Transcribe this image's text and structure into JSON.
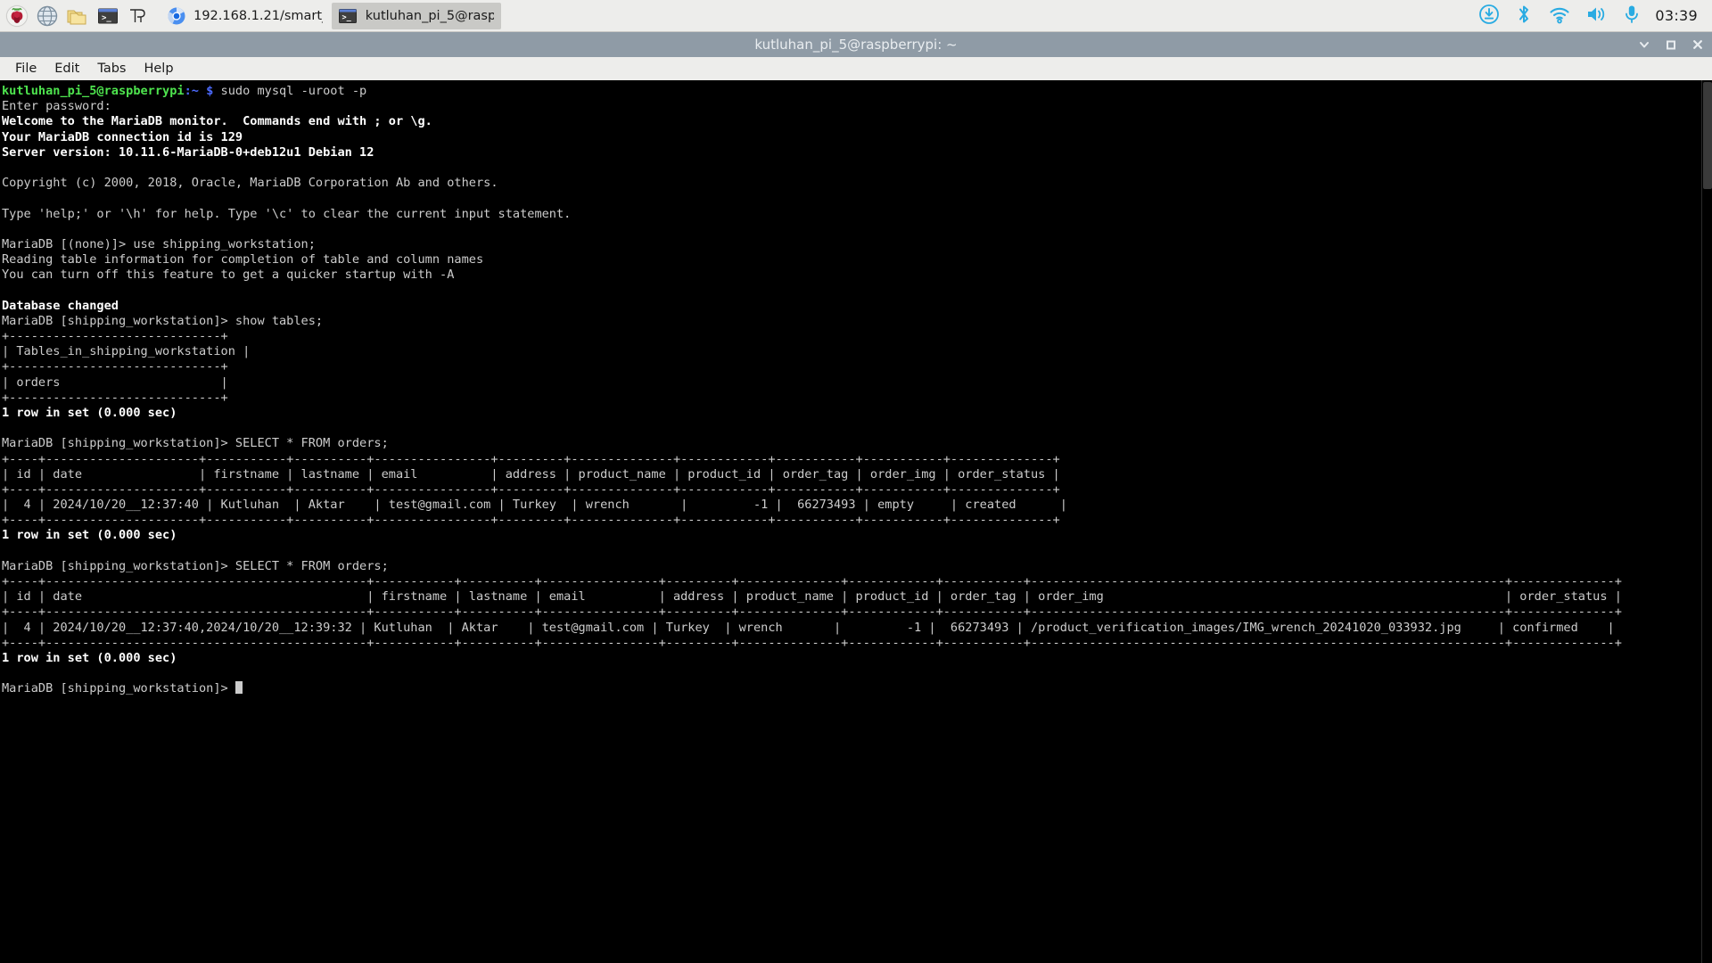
{
  "taskbar": {
    "launchers": [
      {
        "name": "raspberry-menu-icon",
        "label": "Raspberry Pi Menu"
      },
      {
        "name": "globe-browser-icon",
        "label": "Web Browser"
      },
      {
        "name": "file-manager-icon",
        "label": "File Manager"
      },
      {
        "name": "terminal-icon",
        "label": "Terminal"
      },
      {
        "name": "thonny-icon",
        "label": "Thonny"
      }
    ],
    "windows": [
      {
        "name": "taskbar-window-chromium",
        "icon": "chromium-icon",
        "label": "192.168.1.21/smart_..",
        "active": false
      },
      {
        "name": "taskbar-window-terminal",
        "icon": "terminal-icon",
        "label": "kutluhan_pi_5@rasp..",
        "active": true
      }
    ],
    "tray": [
      {
        "name": "software-update-icon"
      },
      {
        "name": "bluetooth-icon"
      },
      {
        "name": "wifi-icon"
      },
      {
        "name": "volume-icon"
      },
      {
        "name": "microphone-icon"
      }
    ],
    "clock": "03:39"
  },
  "window": {
    "title": "kutluhan_pi_5@raspberrypi: ~",
    "controls": [
      {
        "name": "minimize-button",
        "glyph": "chevron-down-icon"
      },
      {
        "name": "maximize-button",
        "glyph": "square-icon"
      },
      {
        "name": "close-button",
        "glyph": "close-icon"
      }
    ],
    "menu": [
      {
        "name": "menu-file",
        "label": "File"
      },
      {
        "name": "menu-edit",
        "label": "Edit"
      },
      {
        "name": "menu-tabs",
        "label": "Tabs"
      },
      {
        "name": "menu-help",
        "label": "Help"
      }
    ]
  },
  "terminal": {
    "prompt_user": "kutluhan_pi_5@raspberrypi",
    "prompt_path": ":~",
    "prompt_symbol": "$",
    "shell_command": " sudo mysql -uroot -p",
    "mysql_prompt_none": "MariaDB [(none)]> ",
    "mysql_prompt_db": "MariaDB [shipping_workstation]> ",
    "cursor": "block-cursor",
    "lines": [
      {
        "type": "shell-prompt"
      },
      {
        "type": "plain",
        "text": "Enter password:"
      },
      {
        "type": "bold",
        "text": "Welcome to the MariaDB monitor.  Commands end with ; or \\g."
      },
      {
        "type": "bold",
        "text": "Your MariaDB connection id is 129"
      },
      {
        "type": "bold",
        "text": "Server version: 10.11.6-MariaDB-0+deb12u1 Debian 12"
      },
      {
        "type": "plain",
        "text": ""
      },
      {
        "type": "plain",
        "text": "Copyright (c) 2000, 2018, Oracle, MariaDB Corporation Ab and others."
      },
      {
        "type": "plain",
        "text": ""
      },
      {
        "type": "plain",
        "text": "Type 'help;' or '\\h' for help. Type '\\c' to clear the current input statement."
      },
      {
        "type": "plain",
        "text": ""
      },
      {
        "type": "mysql-cmd-none",
        "text": "use shipping_workstation;"
      },
      {
        "type": "plain",
        "text": "Reading table information for completion of table and column names"
      },
      {
        "type": "plain",
        "text": "You can turn off this feature to get a quicker startup with -A"
      },
      {
        "type": "plain",
        "text": ""
      },
      {
        "type": "bold",
        "text": "Database changed"
      },
      {
        "type": "mysql-cmd-db",
        "text": "show tables;"
      },
      {
        "type": "plain",
        "text": "+-----------------------------+"
      },
      {
        "type": "plain",
        "text": "| Tables_in_shipping_workstation |"
      },
      {
        "type": "plain",
        "text": "+-----------------------------+"
      },
      {
        "type": "plain",
        "text": "| orders                      |"
      },
      {
        "type": "plain",
        "text": "+-----------------------------+"
      },
      {
        "type": "bold",
        "text": "1 row in set (0.000 sec)"
      },
      {
        "type": "plain",
        "text": ""
      },
      {
        "type": "mysql-cmd-db",
        "text": "SELECT * FROM orders;"
      },
      {
        "type": "plain",
        "text": "+----+---------------------+-----------+----------+----------------+---------+--------------+------------+-----------+-----------+--------------+"
      },
      {
        "type": "plain",
        "text": "| id | date                | firstname | lastname | email          | address | product_name | product_id | order_tag | order_img | order_status |"
      },
      {
        "type": "plain",
        "text": "+----+---------------------+-----------+----------+----------------+---------+--------------+------------+-----------+-----------+--------------+"
      },
      {
        "type": "plain",
        "text": "|  4 | 2024/10/20__12:37:40 | Kutluhan  | Aktar    | test@gmail.com | Turkey  | wrench       |         -1 |  66273493 | empty     | created      |"
      },
      {
        "type": "plain",
        "text": "+----+---------------------+-----------+----------+----------------+---------+--------------+------------+-----------+-----------+--------------+"
      },
      {
        "type": "bold",
        "text": "1 row in set (0.000 sec)"
      },
      {
        "type": "plain",
        "text": ""
      },
      {
        "type": "mysql-cmd-db",
        "text": "SELECT * FROM orders;"
      },
      {
        "type": "plain",
        "text": "+----+--------------------------------------------+-----------+----------+----------------+---------+--------------+------------+-----------+-----------------------------------------------------------------+--------------+"
      },
      {
        "type": "plain",
        "text": "| id | date                                       | firstname | lastname | email          | address | product_name | product_id | order_tag | order_img                                                       | order_status |"
      },
      {
        "type": "plain",
        "text": "+----+--------------------------------------------+-----------+----------+----------------+---------+--------------+------------+-----------+-----------------------------------------------------------------+--------------+"
      },
      {
        "type": "plain",
        "text": "|  4 | 2024/10/20__12:37:40,2024/10/20__12:39:32 | Kutluhan  | Aktar    | test@gmail.com | Turkey  | wrench       |         -1 |  66273493 | /product_verification_images/IMG_wrench_20241020_033932.jpg     | confirmed    |"
      },
      {
        "type": "plain",
        "text": "+----+--------------------------------------------+-----------+----------+----------------+---------+--------------+------------+-----------+-----------------------------------------------------------------+--------------+"
      },
      {
        "type": "bold",
        "text": "1 row in set (0.000 sec)"
      },
      {
        "type": "plain",
        "text": ""
      },
      {
        "type": "mysql-prompt-cursor"
      }
    ]
  },
  "sql_results": {
    "tables_query": {
      "query": "show tables;",
      "columns": [
        "Tables_in_shipping_workstation"
      ],
      "rows": [
        [
          "orders"
        ]
      ],
      "status": "1 row in set (0.000 sec)"
    },
    "orders_query_first": {
      "query": "SELECT * FROM orders;",
      "columns": [
        "id",
        "date",
        "firstname",
        "lastname",
        "email",
        "address",
        "product_name",
        "product_id",
        "order_tag",
        "order_img",
        "order_status"
      ],
      "rows": [
        [
          "4",
          "2024/10/20__12:37:40",
          "Kutluhan",
          "Aktar",
          "test@gmail.com",
          "Turkey",
          "wrench",
          "-1",
          "66273493",
          "empty",
          "created"
        ]
      ],
      "status": "1 row in set (0.000 sec)"
    },
    "orders_query_second": {
      "query": "SELECT * FROM orders;",
      "columns": [
        "id",
        "date",
        "firstname",
        "lastname",
        "email",
        "address",
        "product_name",
        "product_id",
        "order_tag",
        "order_img",
        "order_status"
      ],
      "rows": [
        [
          "4",
          "2024/10/20__12:37:40,2024/10/20__12:39:32",
          "Kutluhan",
          "Aktar",
          "test@gmail.com",
          "Turkey",
          "wrench",
          "-1",
          "66273493",
          "/product_verification_images/IMG_wrench_20241020_033932.jpg",
          "confirmed"
        ]
      ],
      "status": "1 row in set (0.000 sec)"
    }
  },
  "colors": {
    "taskbar_bg": "#ededeb",
    "titlebar_bg": "#8f9ba6",
    "terminal_bg": "#000000",
    "terminal_fg": "#cccccc",
    "prompt_green": "#4ee44e",
    "prompt_blue": "#4d6bff",
    "tray_accent": "#29abe2"
  }
}
